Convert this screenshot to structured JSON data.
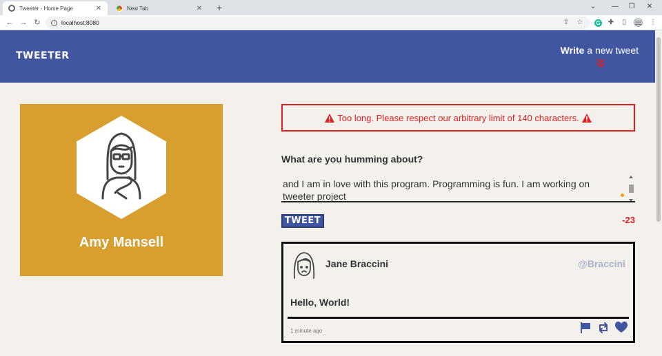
{
  "browser": {
    "tabs": [
      {
        "title": "Tweeter - Home Page",
        "close": "✕"
      },
      {
        "title": "New Tab",
        "close": "✕"
      }
    ],
    "new_tab_glyph": "+",
    "window_controls": {
      "dropdown": "⌄",
      "minimize": "—",
      "restore": "❐",
      "close": "✕"
    },
    "url": "localhost:8080",
    "nav": {
      "back": "←",
      "forward": "→",
      "reload": "↻"
    },
    "toolbar_icons": {
      "share": "⇪",
      "bookmark": "☆",
      "grammarly": "G",
      "extensions": "✚",
      "sidebar": "▯",
      "menu": "⋮"
    }
  },
  "nav": {
    "brand": "TWEETER",
    "write_bold": "Write",
    "write_rest": " a new tweet",
    "accent": "#e02020"
  },
  "profile": {
    "name": "Amy Mansell",
    "card_color": "#d89f2e"
  },
  "compose": {
    "error": "Too long. Please respect our arbitrary limit of 140 characters.",
    "label": "What are you humming about?",
    "text_cut": "and I am in love with this program. Programming is fun. I am working on tweeter",
    "text_visible": "and I am in love with this program. Programming is fun. I am working on tweeter project",
    "button": "TWEET",
    "counter": "-23"
  },
  "tweet": {
    "name": "Jane Braccini",
    "handle": "@Braccini",
    "body": "Hello, World!",
    "time": "1 minute ago",
    "icon_color": "#4056a1"
  }
}
